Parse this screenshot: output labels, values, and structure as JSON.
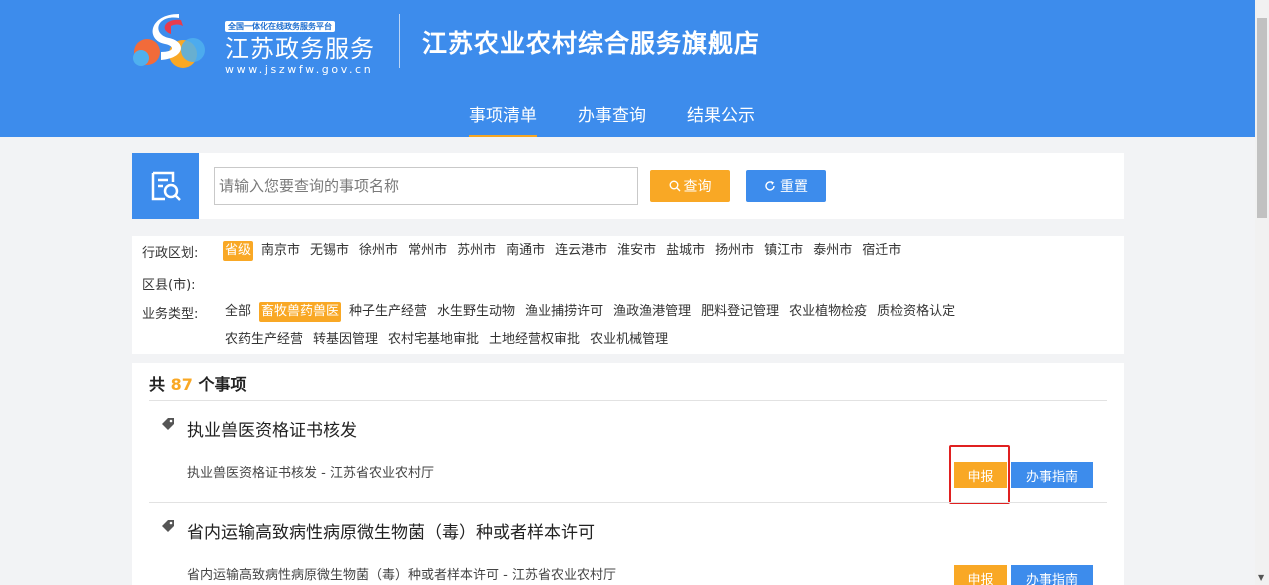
{
  "header": {
    "platform_tag": "全国一体化在线政务服务平台",
    "brand_name": "江苏政务服务",
    "brand_url": "www.jszwfw.gov.cn",
    "store_title": "江苏农业农村综合服务旗舰店",
    "nav": [
      {
        "label": "事项清单",
        "active": true
      },
      {
        "label": "办事查询",
        "active": false
      },
      {
        "label": "结果公示",
        "active": false
      }
    ]
  },
  "search": {
    "placeholder": "请输入您要查询的事项名称",
    "value": "",
    "query_label": "查询",
    "reset_label": "重置"
  },
  "filters": {
    "region_label": "行政区划:",
    "regions": [
      {
        "label": "省级",
        "active": true
      },
      {
        "label": "南京市"
      },
      {
        "label": "无锡市"
      },
      {
        "label": "徐州市"
      },
      {
        "label": "常州市"
      },
      {
        "label": "苏州市"
      },
      {
        "label": "南通市"
      },
      {
        "label": "连云港市"
      },
      {
        "label": "淮安市"
      },
      {
        "label": "盐城市"
      },
      {
        "label": "扬州市"
      },
      {
        "label": "镇江市"
      },
      {
        "label": "泰州市"
      },
      {
        "label": "宿迁市"
      }
    ],
    "county_label": "区县(市):",
    "business_label": "业务类型:",
    "business_row1": [
      {
        "label": "全部"
      },
      {
        "label": "畜牧兽药兽医",
        "active": true
      },
      {
        "label": "种子生产经营"
      },
      {
        "label": "水生野生动物"
      },
      {
        "label": "渔业捕捞许可"
      },
      {
        "label": "渔政渔港管理"
      },
      {
        "label": "肥料登记管理"
      },
      {
        "label": "农业植物检疫"
      },
      {
        "label": "质检资格认定"
      }
    ],
    "business_row2": [
      {
        "label": "农药生产经营"
      },
      {
        "label": "转基因管理"
      },
      {
        "label": "农村宅基地审批"
      },
      {
        "label": "土地经营权审批"
      },
      {
        "label": "农业机械管理"
      }
    ]
  },
  "results": {
    "count_prefix": "共",
    "count": "87",
    "count_suffix": "个事项",
    "items": [
      {
        "title": "执业兽医资格证书核发",
        "subtitle": "执业兽医资格证书核发 - 江苏省农业农村厅",
        "apply_label": "申报",
        "guide_label": "办事指南"
      },
      {
        "title": "省内运输高致病性病原微生物菌（毒）种或者样本许可",
        "subtitle": "省内运输高致病性病原微生物菌（毒）种或者样本许可 - 江苏省农业农村厅",
        "apply_label": "申报",
        "guide_label": "办事指南"
      }
    ]
  },
  "colors": {
    "header_blue": "#3d8cec",
    "accent_orange": "#f9a825",
    "highlight_red": "#e02020"
  }
}
